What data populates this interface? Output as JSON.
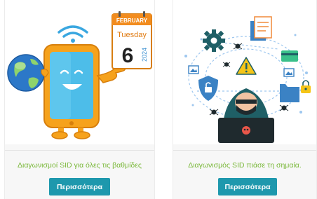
{
  "cards": [
    {
      "title": "Διαγωνισμοί SID για όλες τις βαθμίδες",
      "button_label": "Περισσότερα",
      "calendar": {
        "month": "FEBRUARY",
        "weekday": "Tuesday",
        "day": "6",
        "year": "2024"
      }
    },
    {
      "title": "Διαγωνισμός SID πιάσε τη σημαία.",
      "button_label": "Περισσότερα"
    }
  ],
  "colors": {
    "title_green": "#7ab83a",
    "button_teal": "#1e98ad",
    "calendar_orange": "#f28c1e",
    "phone_orange": "#f6a21c",
    "phone_screen": "#4dbde9",
    "globe_blue": "#2c78c8",
    "hacker_teal": "#1f5f66"
  }
}
